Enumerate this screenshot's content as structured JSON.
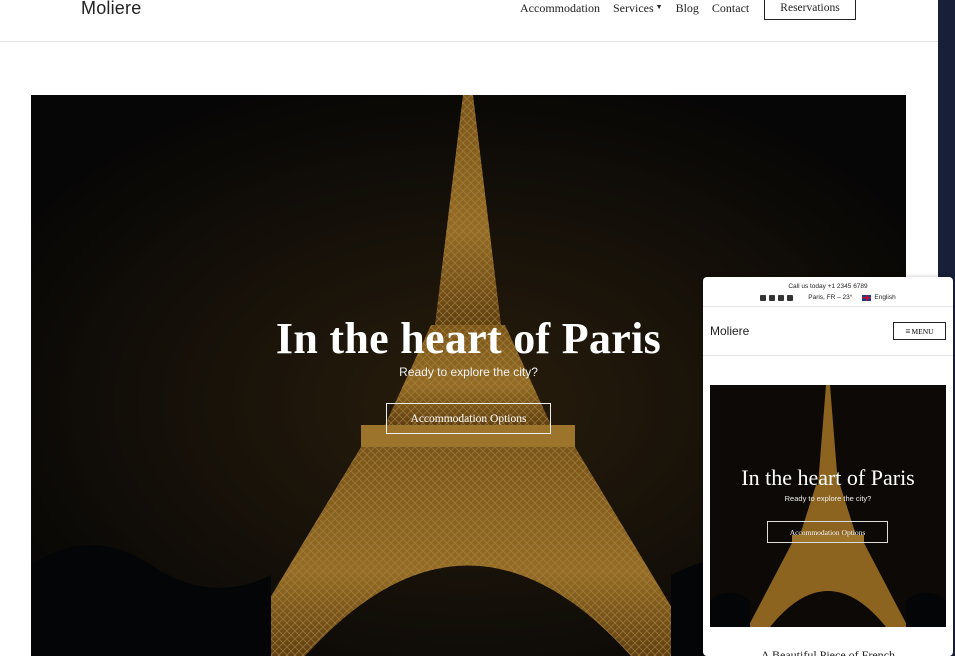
{
  "header": {
    "logo": "Moliere",
    "nav": [
      {
        "label": "Accommodation"
      },
      {
        "label": "Services",
        "has_dropdown": true
      },
      {
        "label": "Blog"
      },
      {
        "label": "Contact"
      }
    ],
    "reservations_label": "Reservations"
  },
  "hero": {
    "title": "In the heart of Paris",
    "subtitle": "Ready to explore the city?",
    "button_label": "Accommodation Options"
  },
  "mobile": {
    "call_text": "Call us today +1 2345 6789",
    "social_icons": [
      "facebook-icon",
      "twitter-icon",
      "instagram-icon",
      "youtube-icon"
    ],
    "weather": "Paris, FR – 23°",
    "language": "English",
    "logo": "Moliere",
    "menu_label": "MENU",
    "hero_title": "In the heart of Paris",
    "hero_subtitle": "Ready to explore the city?",
    "hero_button": "Accommodation Options",
    "next_heading_partial": "A Beautiful Piece of French"
  },
  "colors": {
    "text_dark": "#222222",
    "edge_strip": "#172038",
    "tower_gold": "#c9902e"
  }
}
